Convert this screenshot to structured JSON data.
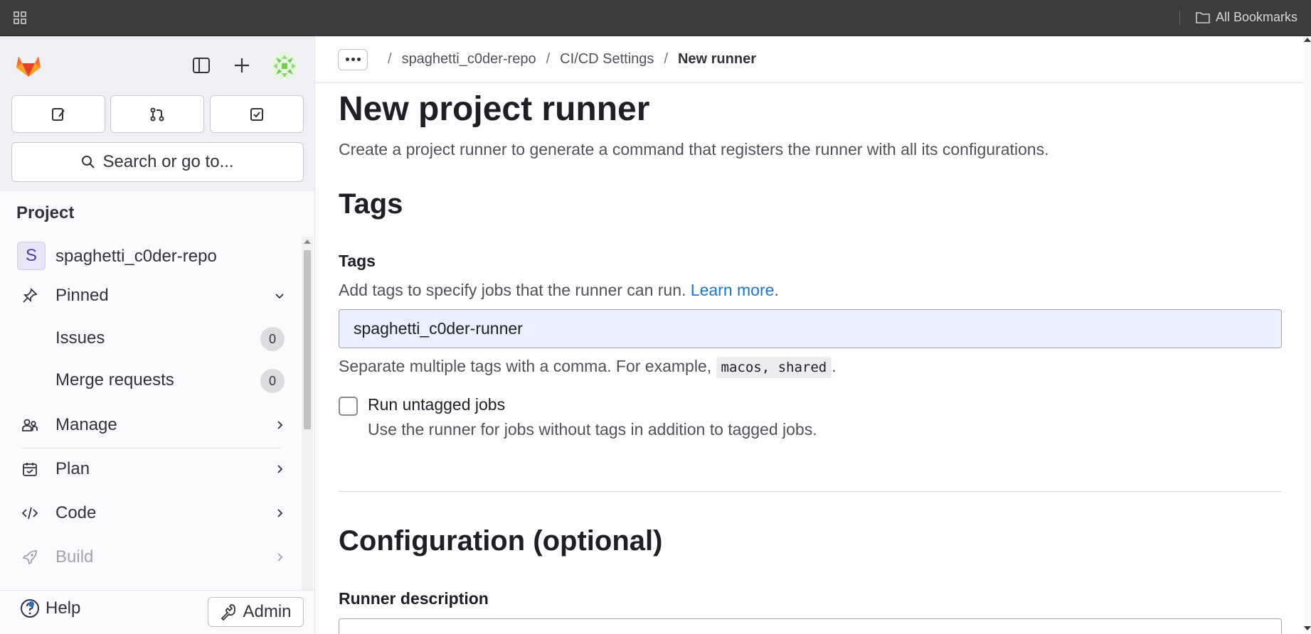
{
  "browser": {
    "bookmarks_label": "All Bookmarks",
    "icons": [
      "apps-grid-icon",
      "folder-icon"
    ]
  },
  "sidebar": {
    "section_title": "Project",
    "search_label": "Search or go to...",
    "top_buttons": [
      "issues-icon",
      "merge-request-icon",
      "todo-icon"
    ],
    "project": {
      "avatar_letter": "S",
      "name": "spaghetti_c0der-repo"
    },
    "pinned": {
      "label": "Pinned",
      "items": [
        {
          "label": "Issues",
          "count": "0"
        },
        {
          "label": "Merge requests",
          "count": "0"
        }
      ]
    },
    "sections": [
      {
        "label": "Manage",
        "icon": "users-icon"
      },
      {
        "label": "Plan",
        "icon": "calendar-icon"
      },
      {
        "label": "Code",
        "icon": "code-icon"
      },
      {
        "label": "Build",
        "icon": "rocket-icon"
      }
    ],
    "help_label": "Help",
    "admin_label": "Admin"
  },
  "breadcrumb": [
    "spaghetti_c0der-repo",
    "CI/CD Settings",
    "New runner"
  ],
  "page": {
    "title": "New project runner",
    "description": "Create a project runner to generate a command that registers the runner with all its configurations."
  },
  "tags": {
    "heading": "Tags",
    "label": "Tags",
    "help_prefix": "Add tags to specify jobs that the runner can run.",
    "learn_more": "Learn more",
    "help_suffix": ".",
    "value": "spaghetti_c0der-runner",
    "separator_help": "Separate multiple tags with a comma. For example,",
    "example_code": "macos, shared",
    "separator_suffix": ".",
    "untagged_label": "Run untagged jobs",
    "untagged_help": "Use the runner for jobs without tags in addition to tagged jobs.",
    "untagged_checked": false
  },
  "configuration": {
    "heading": "Configuration (optional)",
    "description_label": "Runner description"
  },
  "colors": {
    "accent": "#1f75cb",
    "sidebar_bg": "#fbfafd",
    "input_autofill": "#e8f0fe"
  }
}
